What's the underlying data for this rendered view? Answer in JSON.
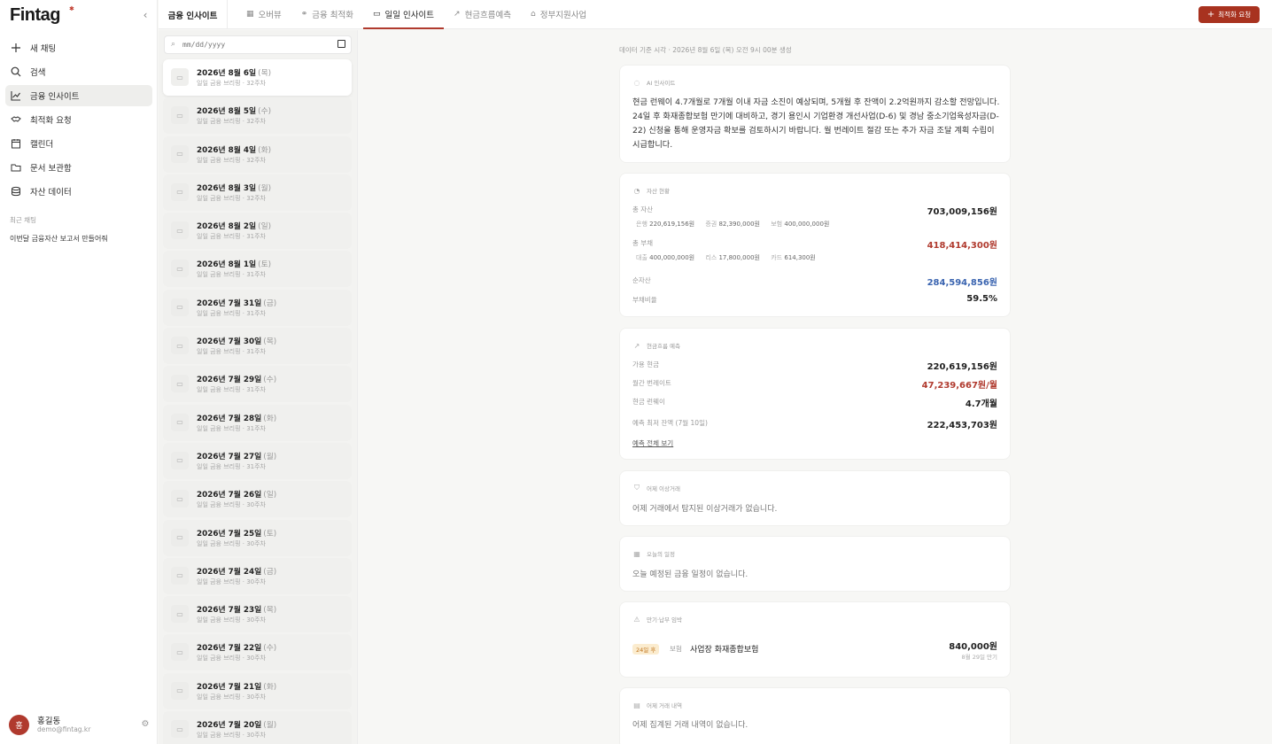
{
  "app": {
    "logo": "Fintag"
  },
  "sidebar": {
    "nav": [
      {
        "label": "새 채팅",
        "icon": "plus-icon"
      },
      {
        "label": "검색",
        "icon": "search-icon"
      },
      {
        "label": "금융 인사이트",
        "icon": "chart-line-icon",
        "active": true
      },
      {
        "label": "최적화 요청",
        "icon": "handshake-icon"
      },
      {
        "label": "캘린더",
        "icon": "calendar-icon"
      },
      {
        "label": "문서 보관함",
        "icon": "folder-icon"
      },
      {
        "label": "자산 데이터",
        "icon": "database-icon"
      }
    ],
    "recent_title": "최근 채팅",
    "recent_items": [
      "이번달 금융자산 보고서 만들어줘"
    ],
    "user": {
      "initial": "홍",
      "name": "홍길동",
      "email": "demo@fintag.kr"
    }
  },
  "topbar": {
    "section_title": "금융 인사이트",
    "tabs": [
      {
        "label": "오버뷰",
        "icon": "grid-icon"
      },
      {
        "label": "금융 최적화",
        "icon": "handshake-icon"
      },
      {
        "label": "일일 인사이트",
        "icon": "briefing-icon",
        "active": true
      },
      {
        "label": "현금흐름예측",
        "icon": "chart-line-icon"
      },
      {
        "label": "정부지원사업",
        "icon": "bank-icon"
      }
    ],
    "primary_button": "최적화 요청"
  },
  "list": {
    "date_placeholder": "mm/dd/yyyy",
    "items": [
      {
        "date": "2026년 8월 6일",
        "dow": "(목)",
        "sub": "일일 금융 브리핑 · 32주차"
      },
      {
        "date": "2026년 8월 5일",
        "dow": "(수)",
        "sub": "일일 금융 브리핑 · 32주차"
      },
      {
        "date": "2026년 8월 4일",
        "dow": "(화)",
        "sub": "일일 금융 브리핑 · 32주차"
      },
      {
        "date": "2026년 8월 3일",
        "dow": "(월)",
        "sub": "일일 금융 브리핑 · 32주차"
      },
      {
        "date": "2026년 8월 2일",
        "dow": "(일)",
        "sub": "일일 금융 브리핑 · 31주차"
      },
      {
        "date": "2026년 8월 1일",
        "dow": "(토)",
        "sub": "일일 금융 브리핑 · 31주차"
      },
      {
        "date": "2026년 7월 31일",
        "dow": "(금)",
        "sub": "일일 금융 브리핑 · 31주차"
      },
      {
        "date": "2026년 7월 30일",
        "dow": "(목)",
        "sub": "일일 금융 브리핑 · 31주차"
      },
      {
        "date": "2026년 7월 29일",
        "dow": "(수)",
        "sub": "일일 금융 브리핑 · 31주차"
      },
      {
        "date": "2026년 7월 28일",
        "dow": "(화)",
        "sub": "일일 금융 브리핑 · 31주차"
      },
      {
        "date": "2026년 7월 27일",
        "dow": "(월)",
        "sub": "일일 금융 브리핑 · 31주차"
      },
      {
        "date": "2026년 7월 26일",
        "dow": "(일)",
        "sub": "일일 금융 브리핑 · 30주차"
      },
      {
        "date": "2026년 7월 25일",
        "dow": "(토)",
        "sub": "일일 금융 브리핑 · 30주차"
      },
      {
        "date": "2026년 7월 24일",
        "dow": "(금)",
        "sub": "일일 금융 브리핑 · 30주차"
      },
      {
        "date": "2026년 7월 23일",
        "dow": "(목)",
        "sub": "일일 금융 브리핑 · 30주차"
      },
      {
        "date": "2026년 7월 22일",
        "dow": "(수)",
        "sub": "일일 금융 브리핑 · 30주차"
      },
      {
        "date": "2026년 7월 21일",
        "dow": "(화)",
        "sub": "일일 금융 브리핑 · 30주차"
      },
      {
        "date": "2026년 7월 20일",
        "dow": "(월)",
        "sub": "일일 금융 브리핑 · 30주차"
      }
    ]
  },
  "content": {
    "meta": "데이터 기준 시각 · 2026년 8월 6일 (목) 오전 9시 00분 생성",
    "insight": {
      "title": "AI 인사이트",
      "text": "현금 런웨이 4.7개월로 7개월 이내 자금 소진이 예상되며, 5개월 후 잔액이 2.2억원까지 감소할 전망입니다. 24일 후 화재종합보험 만기에 대비하고, 경기 용인시 기업환경 개선사업(D-6) 및 경남 중소기업육성자금(D-22) 신청을 통해 운영자금 확보를 검토하시기 바랍니다. 월 번레이트 절감 또는 추가 자금 조달 계획 수립이 시급합니다."
    },
    "assets": {
      "title": "자산 현황",
      "total_assets_label": "총 자산",
      "total_assets": "703,009,156원",
      "assets_breakdown": [
        {
          "k": "은행",
          "v": "220,619,156원"
        },
        {
          "k": "증권",
          "v": "82,390,000원"
        },
        {
          "k": "보험",
          "v": "400,000,000원"
        }
      ],
      "total_liabilities_label": "총 부채",
      "total_liabilities": "418,414,300원",
      "liabilities_breakdown": [
        {
          "k": "대출",
          "v": "400,000,000원"
        },
        {
          "k": "리스",
          "v": "17,800,000원"
        },
        {
          "k": "카드",
          "v": "614,300원"
        }
      ],
      "net_assets_label": "순자산",
      "net_assets": "284,594,856원",
      "debt_ratio_label": "부채비율",
      "debt_ratio": "59.5%"
    },
    "cashflow": {
      "title": "현금흐름 예측",
      "available_cash_label": "가용 현금",
      "available_cash": "220,619,156원",
      "burn_rate_label": "월간 번레이트",
      "burn_rate": "47,239,667원/월",
      "runway_label": "현금 런웨이",
      "runway": "4.7개월",
      "min_balance_label": "예측 최저 잔액 (7월 10일)",
      "min_balance": "222,453,703원",
      "link": "예측 전체 보기"
    },
    "anomaly": {
      "title": "어제 이상거래",
      "text": "어제 거래에서 탐지된 이상거래가 없습니다."
    },
    "schedule": {
      "title": "오늘의 일정",
      "text": "오늘 예정된 금융 일정이 없습니다."
    },
    "maturity": {
      "title": "만기·납부 임박",
      "badge": "24일 후",
      "category": "보험",
      "name": "사업장 화재종합보험",
      "amount": "840,000원",
      "due": "8월 29일 만기"
    },
    "transactions": {
      "title": "어제 거래 내역",
      "text": "어제 집계된 거래 내역이 없습니다."
    },
    "colors": {
      "accent": "#a8321f",
      "negative": "#b03a2e",
      "positive": "#3a64b0"
    }
  }
}
